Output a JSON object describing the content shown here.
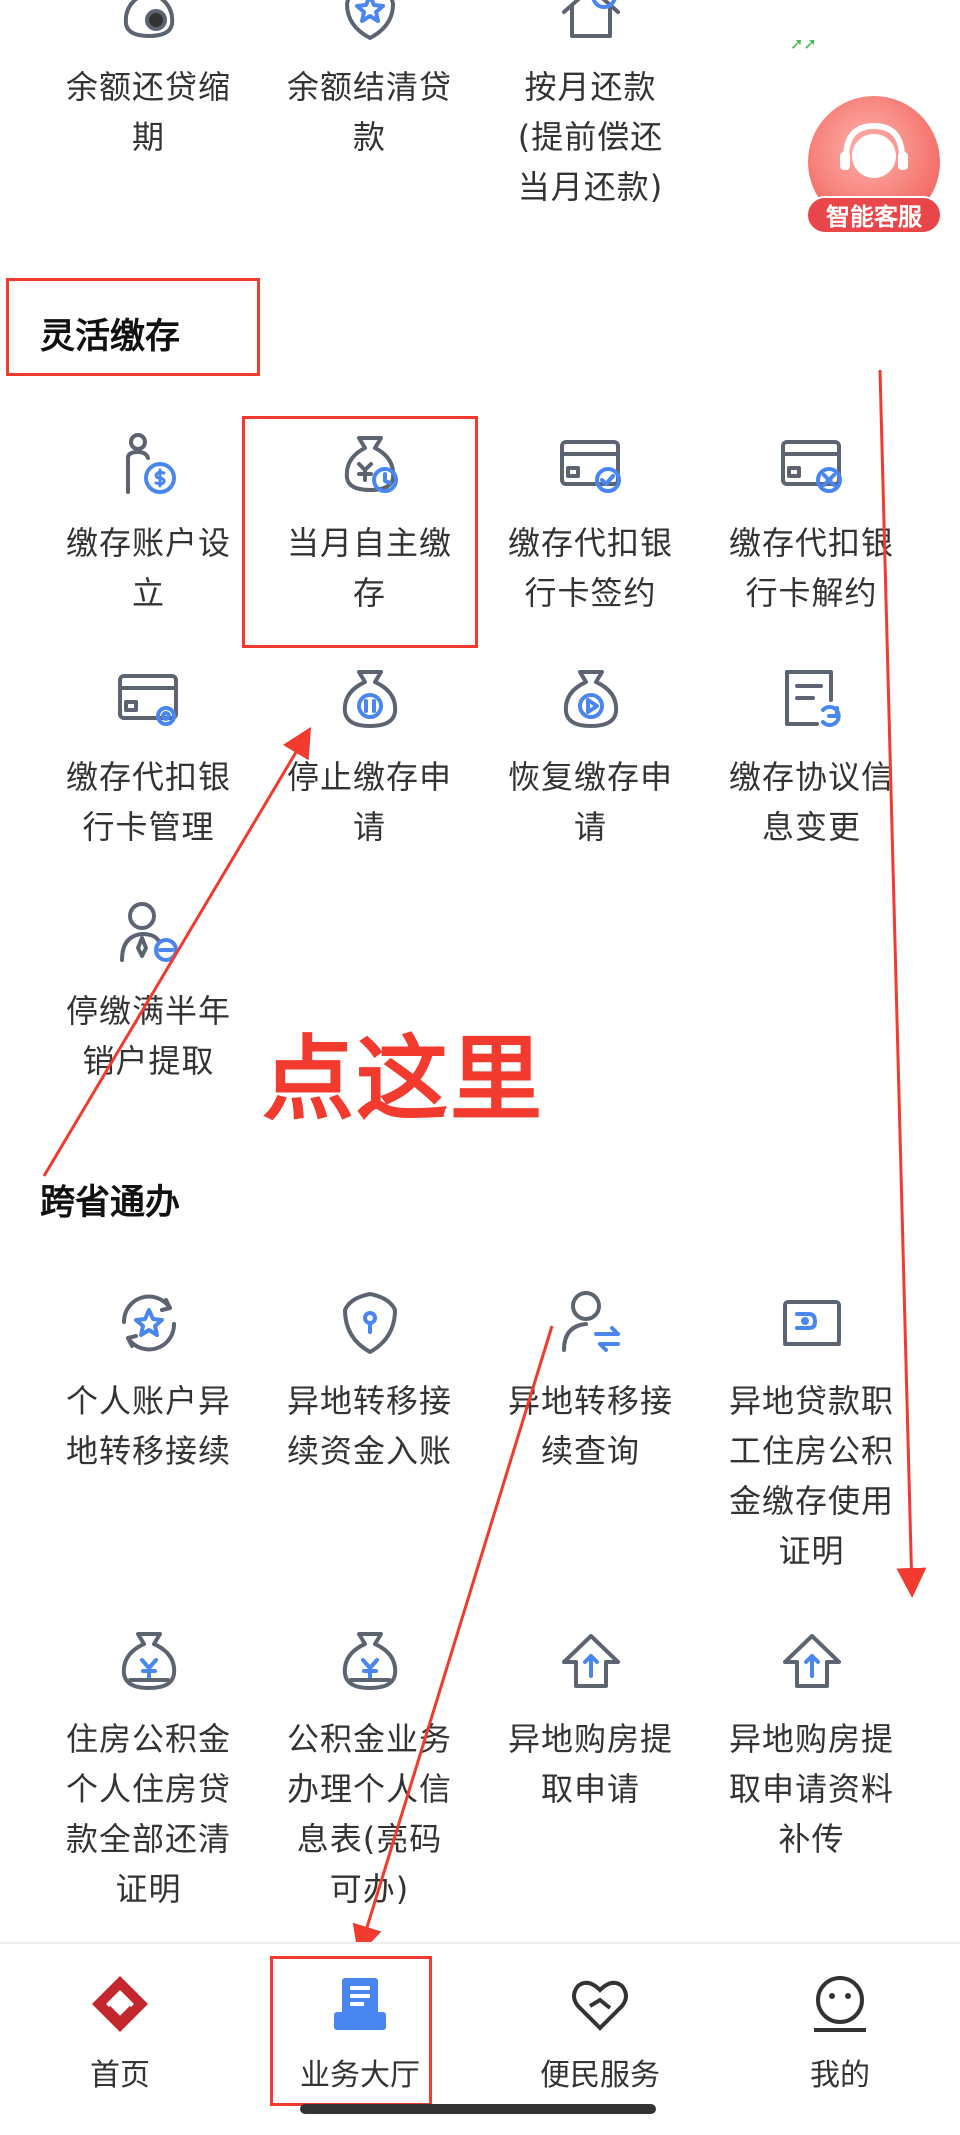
{
  "colors": {
    "accent": "#4a86f0",
    "icon_gray": "#5c6472",
    "annotation_red": "#f23a2e",
    "brand_red": "#c4282e"
  },
  "top_row": [
    {
      "label": "余额还贷缩期",
      "icon": "money-bag-clock-icon"
    },
    {
      "label": "余额结清贷款",
      "icon": "shield-star-icon"
    },
    {
      "label": "按月还款(提前偿还当月还款)",
      "icon": "house-yuan-icon"
    }
  ],
  "customer_service": {
    "label": "智能客服",
    "icon": "headset-agent-icon"
  },
  "flexible_deposit": {
    "title": "灵活缴存",
    "items": [
      {
        "label": "缴存账户设立",
        "icon": "person-dollar-icon"
      },
      {
        "label": "当月自主缴存",
        "icon": "money-bag-clock-icon"
      },
      {
        "label": "缴存代扣银行卡签约",
        "icon": "bank-card-check-icon"
      },
      {
        "label": "缴存代扣银行卡解约",
        "icon": "bank-card-x-icon"
      },
      {
        "label": "缴存代扣银行卡管理",
        "icon": "bank-card-gear-icon"
      },
      {
        "label": "停止缴存申请",
        "icon": "money-bag-pause-icon"
      },
      {
        "label": "恢复缴存申请",
        "icon": "money-bag-play-icon"
      },
      {
        "label": "缴存协议信息变更",
        "icon": "document-refresh-icon"
      },
      {
        "label": "停缴满半年销户提取",
        "icon": "person-minus-icon"
      }
    ]
  },
  "annotation_text": "点这里",
  "cross_province": {
    "title": "跨省通办",
    "items": [
      {
        "label": "个人账户异地转移接续",
        "icon": "circular-star-icon"
      },
      {
        "label": "异地转移接续资金入账",
        "icon": "shield-keyhole-icon"
      },
      {
        "label": "异地转移接续查询",
        "icon": "person-transfer-icon"
      },
      {
        "label": "异地贷款职工住房公积金缴存使用证明",
        "icon": "wallet-icon"
      },
      {
        "label": "住房公积金个人住房贷款全部还清证明",
        "icon": "money-bag-yuan-icon"
      },
      {
        "label": "公积金业务办理个人信息表(亮码可办)",
        "icon": "money-bag-yuan-icon"
      },
      {
        "label": "异地购房提取申请",
        "icon": "house-arrow-up-icon"
      },
      {
        "label": "异地购房提取申请资料补传",
        "icon": "house-arrow-up-icon"
      }
    ]
  },
  "tabbar": [
    {
      "label": "首页",
      "icon": "home-logo-icon"
    },
    {
      "label": "业务大厅",
      "icon": "business-hall-icon"
    },
    {
      "label": "便民服务",
      "icon": "heart-hands-icon"
    },
    {
      "label": "我的",
      "icon": "smile-face-icon"
    }
  ]
}
